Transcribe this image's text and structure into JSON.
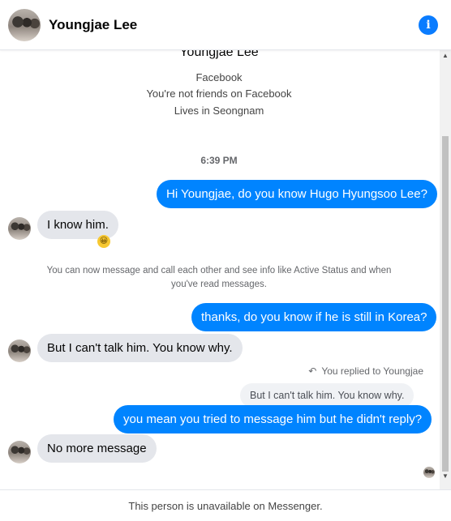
{
  "header": {
    "name": "Youngjae Lee",
    "info_icon": "i"
  },
  "profile": {
    "name": "Youngjae Lee",
    "lines": [
      "Facebook",
      "You're not friends on Facebook",
      "Lives in Seongnam"
    ]
  },
  "timestamp": "6:39 PM",
  "messages": [
    {
      "text": "Hi Youngjae, do you know Hugo Hyungsoo Lee?"
    },
    {
      "text": "I know him."
    },
    {
      "text": "thanks, do you know if he is still in Korea?"
    },
    {
      "text": "But  I can't talk him. You know why."
    },
    {
      "text": "you mean you tried to message him but he didn't reply?"
    },
    {
      "text": "No more message"
    }
  ],
  "system_message": "You can now message and call each other and see info like Active Status and when you've read messages.",
  "reply": {
    "meta": "You replied to Youngjae",
    "quote": "But  I can't talk him. You know why."
  },
  "emoji": "😀",
  "footer": "This person is unavailable on Messenger.",
  "colors": {
    "accent": "#0084ff",
    "incoming_bubble": "#e4e6eb",
    "muted_text": "#65676b"
  }
}
